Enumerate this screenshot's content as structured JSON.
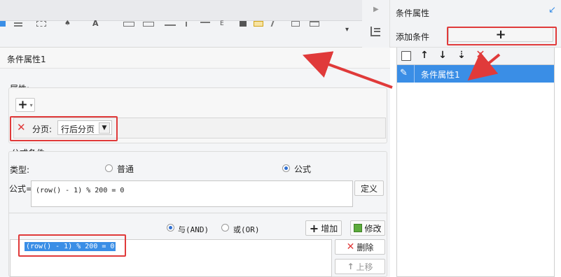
{
  "right_panel": {
    "title": "条件属性",
    "add_condition_label": "添加条件",
    "add_button_glyph": "+",
    "selected_item": "条件属性1",
    "toolbar_icons": [
      "copy-icon",
      "arrow-up-icon",
      "arrow-down-icon",
      "sort-down-icon",
      "delete-icon"
    ]
  },
  "dialog": {
    "title": "条件属性1",
    "attributes": {
      "section_label": "属性:",
      "add_glyph": "+",
      "row_label": "分页:",
      "row_value": "行后分页"
    },
    "formula": {
      "section_label": "公式条件",
      "type_label": "类型:",
      "type_options": [
        "普通",
        "公式"
      ],
      "selected_type": "公式",
      "formula_label": "公式=",
      "formula_value": "(row() - 1) % 200 = 0",
      "define_button": "定义",
      "logic_and": "与(AND)",
      "logic_or": "或(OR)",
      "add_button": "增加",
      "modify_button": "修改",
      "delete_button": "删除",
      "up_button": "上移",
      "condition_item": "(row() - 1) % 200 = 0"
    }
  },
  "colors": {
    "accent": "#3a8ee6",
    "annotation": "#e03a3a",
    "delete": "#e03a3a"
  }
}
